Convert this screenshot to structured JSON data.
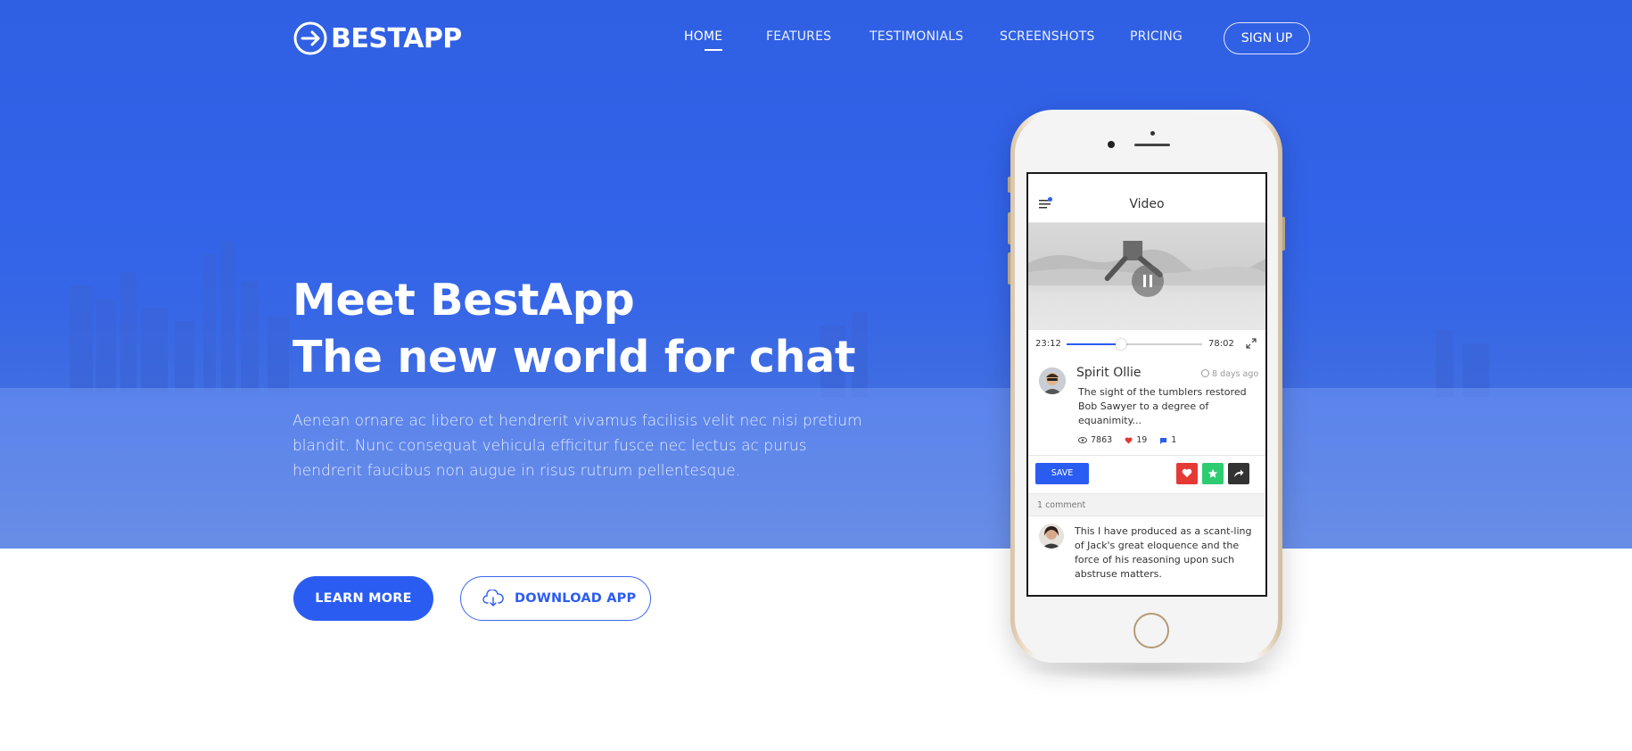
{
  "brand": {
    "name": "BESTAPP"
  },
  "nav": {
    "items": [
      {
        "label": "HOME",
        "active": true
      },
      {
        "label": "FEATURES",
        "active": false
      },
      {
        "label": "TESTIMONIALS",
        "active": false
      },
      {
        "label": "SCREENSHOTS",
        "active": false
      },
      {
        "label": "PRICING",
        "active": false
      }
    ],
    "signup_label": "SIGN UP"
  },
  "hero": {
    "headline_line1": "Meet BestApp",
    "headline_line2": "The new world for chat",
    "lead": "Aenean ornare ac libero et hendrerit vivamus facilisis velit nec nisi pretium blandit. Nunc consequat vehicula efficitur fusce nec lectus ac purus hendrerit faucibus non augue in risus rutrum pellentesque.",
    "learn_more_label": "LEARN MORE",
    "download_label": "DOWNLOAD APP"
  },
  "phone_screen": {
    "title": "Video",
    "video": {
      "time_elapsed": "23:12",
      "time_total": "78:02",
      "progress": 0.4
    },
    "post": {
      "author": "Spirit Ollie",
      "time_ago": "8 days ago",
      "text": "The sight of the tumblers restored Bob Sawyer to a degree of equanimity...",
      "views": "7863",
      "likes": "19",
      "comments": "1"
    },
    "save_label": "SAVE",
    "comments_count_label": "1 comment",
    "comment_text": "This I have produced as a scant-ling of Jack's great eloquence and the force of his reasoning upon such abstruse matters."
  },
  "colors": {
    "accent": "#2b5cf2",
    "hero_blue": "#3263e8",
    "like_red": "#e53935",
    "star_green": "#2ecc71",
    "share_dark": "#333333"
  }
}
